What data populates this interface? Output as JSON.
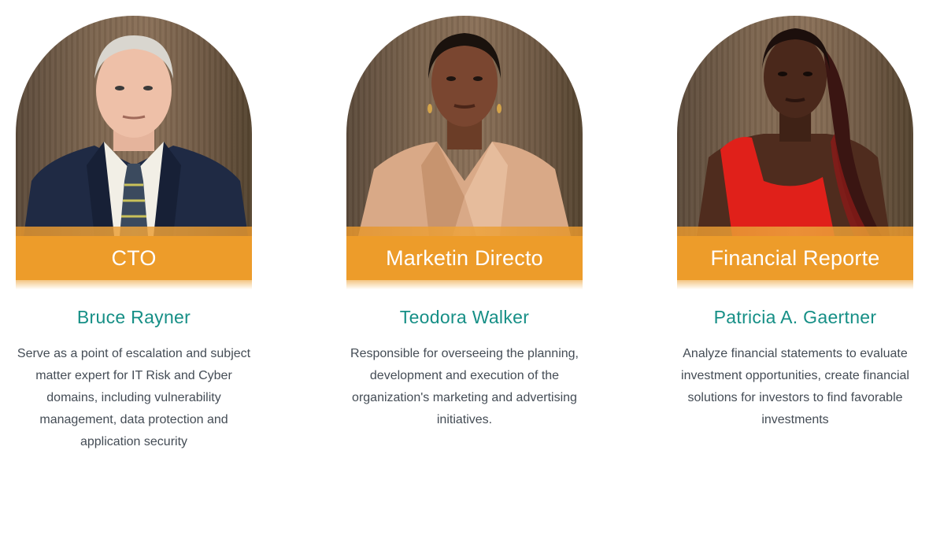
{
  "team": [
    {
      "role": "CTO",
      "name": "Bruce Rayner",
      "bio": "Serve as a point of escalation and subject matter expert for IT Risk and Cyber domains, including vulnerability management, data protection and application security"
    },
    {
      "role": "Marketin Directo",
      "name": "Teodora Walker",
      "bio": "Responsible for overseeing the planning, development and execution of the organization's marketing and advertising initiatives."
    },
    {
      "role": "Financial Reporte",
      "name": "Patricia A. Gaertner",
      "bio": "Analyze financial statements to evaluate investment opportunities, create financial solutions for investors to find favorable investments"
    }
  ],
  "colors": {
    "accent_orange": "#ed9c2a",
    "name_teal": "#168f86",
    "body_text": "#444c55"
  }
}
